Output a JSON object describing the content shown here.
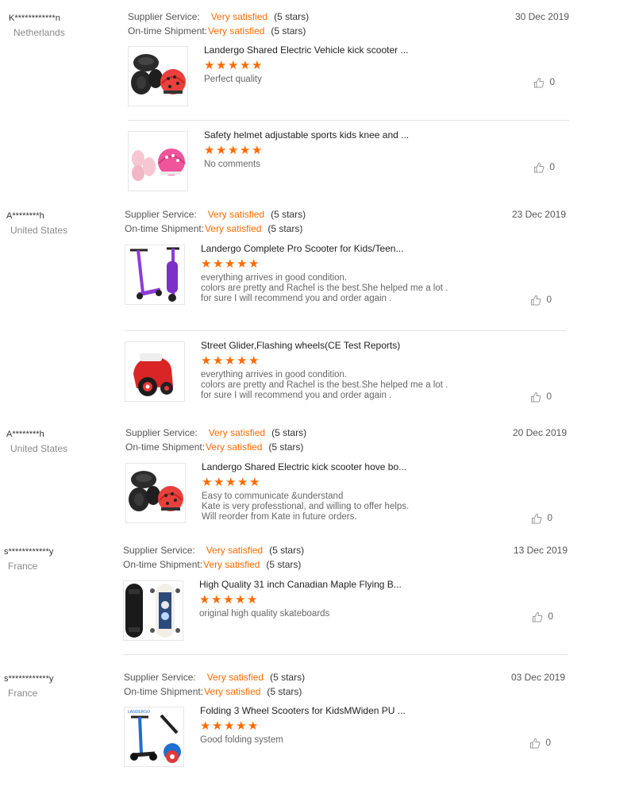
{
  "labels": {
    "supplier_service": "Supplier Service:",
    "ontime_shipment": "On-time Shipment:"
  },
  "colors": {
    "accent": "#ff6a00"
  },
  "reviews": [
    {
      "name": "K************n",
      "country": "Netherlands",
      "date": "30 Dec 2019",
      "supplier": {
        "value": "Very satisfied",
        "stars": "(5 stars)"
      },
      "shipment": {
        "value": "Very satisfied",
        "stars": "(5 stars)"
      },
      "items": [
        {
          "title": "Landergo Shared Electric Vehicle kick scooter ...",
          "rating": 5,
          "comment": [
            "Perfect quality"
          ],
          "likes": "0",
          "thumb": "helmet-pads"
        },
        {
          "title": "Safety helmet adjustable sports kids knee and ...",
          "rating": 5,
          "comment": [
            "No comments"
          ],
          "likes": "0",
          "thumb": "pink-helmet"
        }
      ]
    },
    {
      "name": "A********h",
      "country": "United States",
      "date": "23 Dec 2019",
      "supplier": {
        "value": "Very satisfied",
        "stars": "(5 stars)"
      },
      "shipment": {
        "value": "Very satisfied",
        "stars": "(5 stars)"
      },
      "items": [
        {
          "title": "Landergo Complete Pro Scooter for Kids/Teen...",
          "rating": 5,
          "comment": [
            "everything arrives in good condition.",
            "colors are pretty and Rachel is the best.She helped me a lot .",
            "for sure I will recommend you and order again ."
          ],
          "likes": "0",
          "thumb": "purple-scooter"
        },
        {
          "title": "Street Glider,Flashing wheels(CE Test Reports)",
          "rating": 5,
          "comment": [
            "everything arrives in good condition.",
            "colors are pretty and Rachel is the best.She helped me a lot .",
            "for sure I will recommend you and order again ."
          ],
          "likes": "0",
          "thumb": "red-glider"
        }
      ]
    },
    {
      "name": "A********h",
      "country": "United States",
      "date": "20 Dec 2019",
      "supplier": {
        "value": "Very satisfied",
        "stars": "(5 stars)"
      },
      "shipment": {
        "value": "Very satisfied",
        "stars": "(5 stars)"
      },
      "items": [
        {
          "title": "Landergo Shared Electric kick scooter hove bo...",
          "rating": 5,
          "comment": [
            "Easy to communicate &understand",
            "Kate is very professtional, and willing to offer helps.",
            "Will reorder from Kate in future orders."
          ],
          "likes": "0",
          "thumb": "helmet-pads"
        }
      ]
    },
    {
      "name": "s************y",
      "country": "France",
      "date": "13 Dec 2019",
      "supplier": {
        "value": "Very satisfied",
        "stars": "(5 stars)"
      },
      "shipment": {
        "value": "Very satisfied",
        "stars": "(5 stars)"
      },
      "items": [
        {
          "title": "High Quality 31 inch Canadian Maple Flying B...",
          "rating": 5,
          "comment": [
            "original high quality skateboards"
          ],
          "likes": "0",
          "thumb": "skateboard"
        }
      ]
    },
    {
      "name": "s************y",
      "country": "France",
      "date": "03 Dec 2019",
      "supplier": {
        "value": "Very satisfied",
        "stars": "(5 stars)"
      },
      "shipment": {
        "value": "Very satisfied",
        "stars": "(5 stars)"
      },
      "items": [
        {
          "title": "Folding 3 Wheel Scooters for KidsMWiden PU ...",
          "rating": 5,
          "comment": [
            "Good folding system"
          ],
          "likes": "0",
          "thumb": "blue-scooter"
        }
      ]
    }
  ]
}
